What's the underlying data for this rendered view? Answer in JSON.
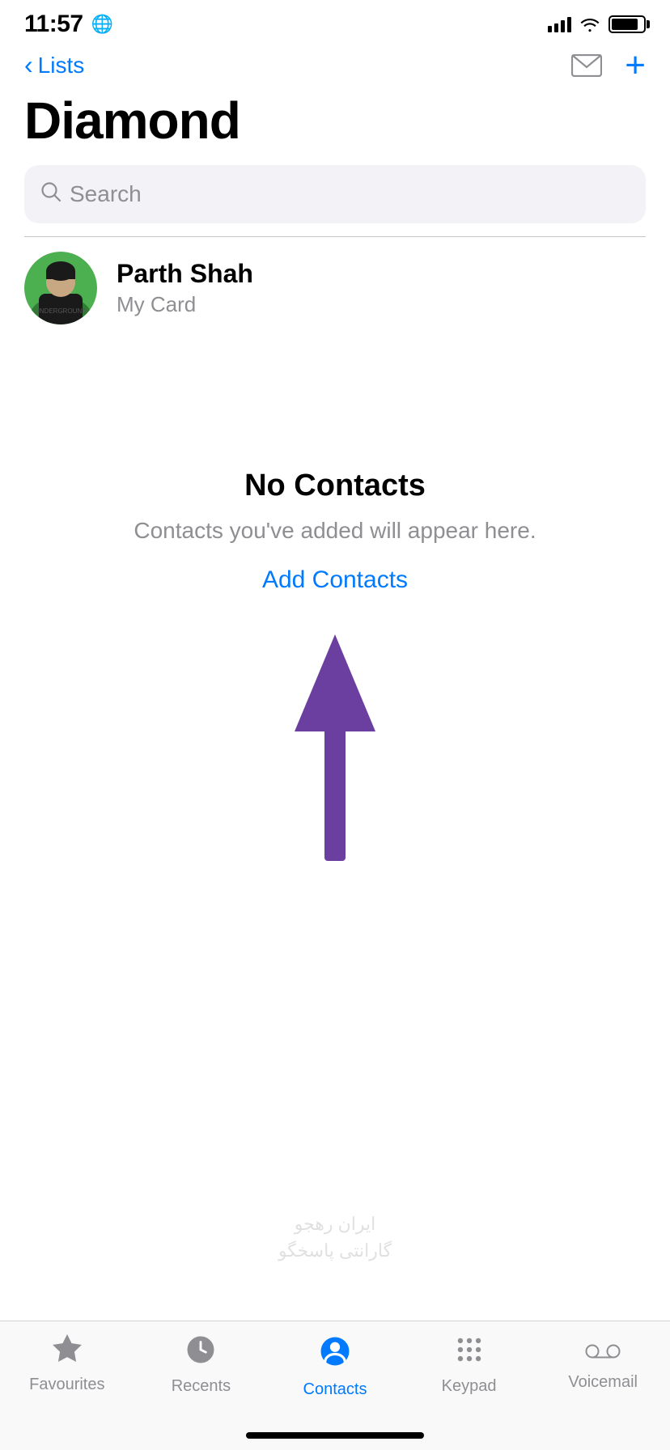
{
  "statusBar": {
    "time": "11:57",
    "globeIcon": "🌐"
  },
  "navBar": {
    "backLabel": "Lists",
    "mailIconLabel": "mail-icon",
    "addIconLabel": "add-icon"
  },
  "pageTitle": "Diamond",
  "search": {
    "placeholder": "Search"
  },
  "myCard": {
    "name": "Parth Shah",
    "subtitle": "My Card"
  },
  "emptyState": {
    "title": "No Contacts",
    "subtitle": "Contacts you've added will appear here.",
    "addButton": "Add Contacts"
  },
  "tabBar": {
    "tabs": [
      {
        "id": "favourites",
        "label": "Favourites",
        "active": false
      },
      {
        "id": "recents",
        "label": "Recents",
        "active": false
      },
      {
        "id": "contacts",
        "label": "Contacts",
        "active": true
      },
      {
        "id": "keypad",
        "label": "Keypad",
        "active": false
      },
      {
        "id": "voicemail",
        "label": "Voicemail",
        "active": false
      }
    ]
  },
  "colors": {
    "accent": "#007AFF",
    "purple": "#6B3FA0"
  }
}
